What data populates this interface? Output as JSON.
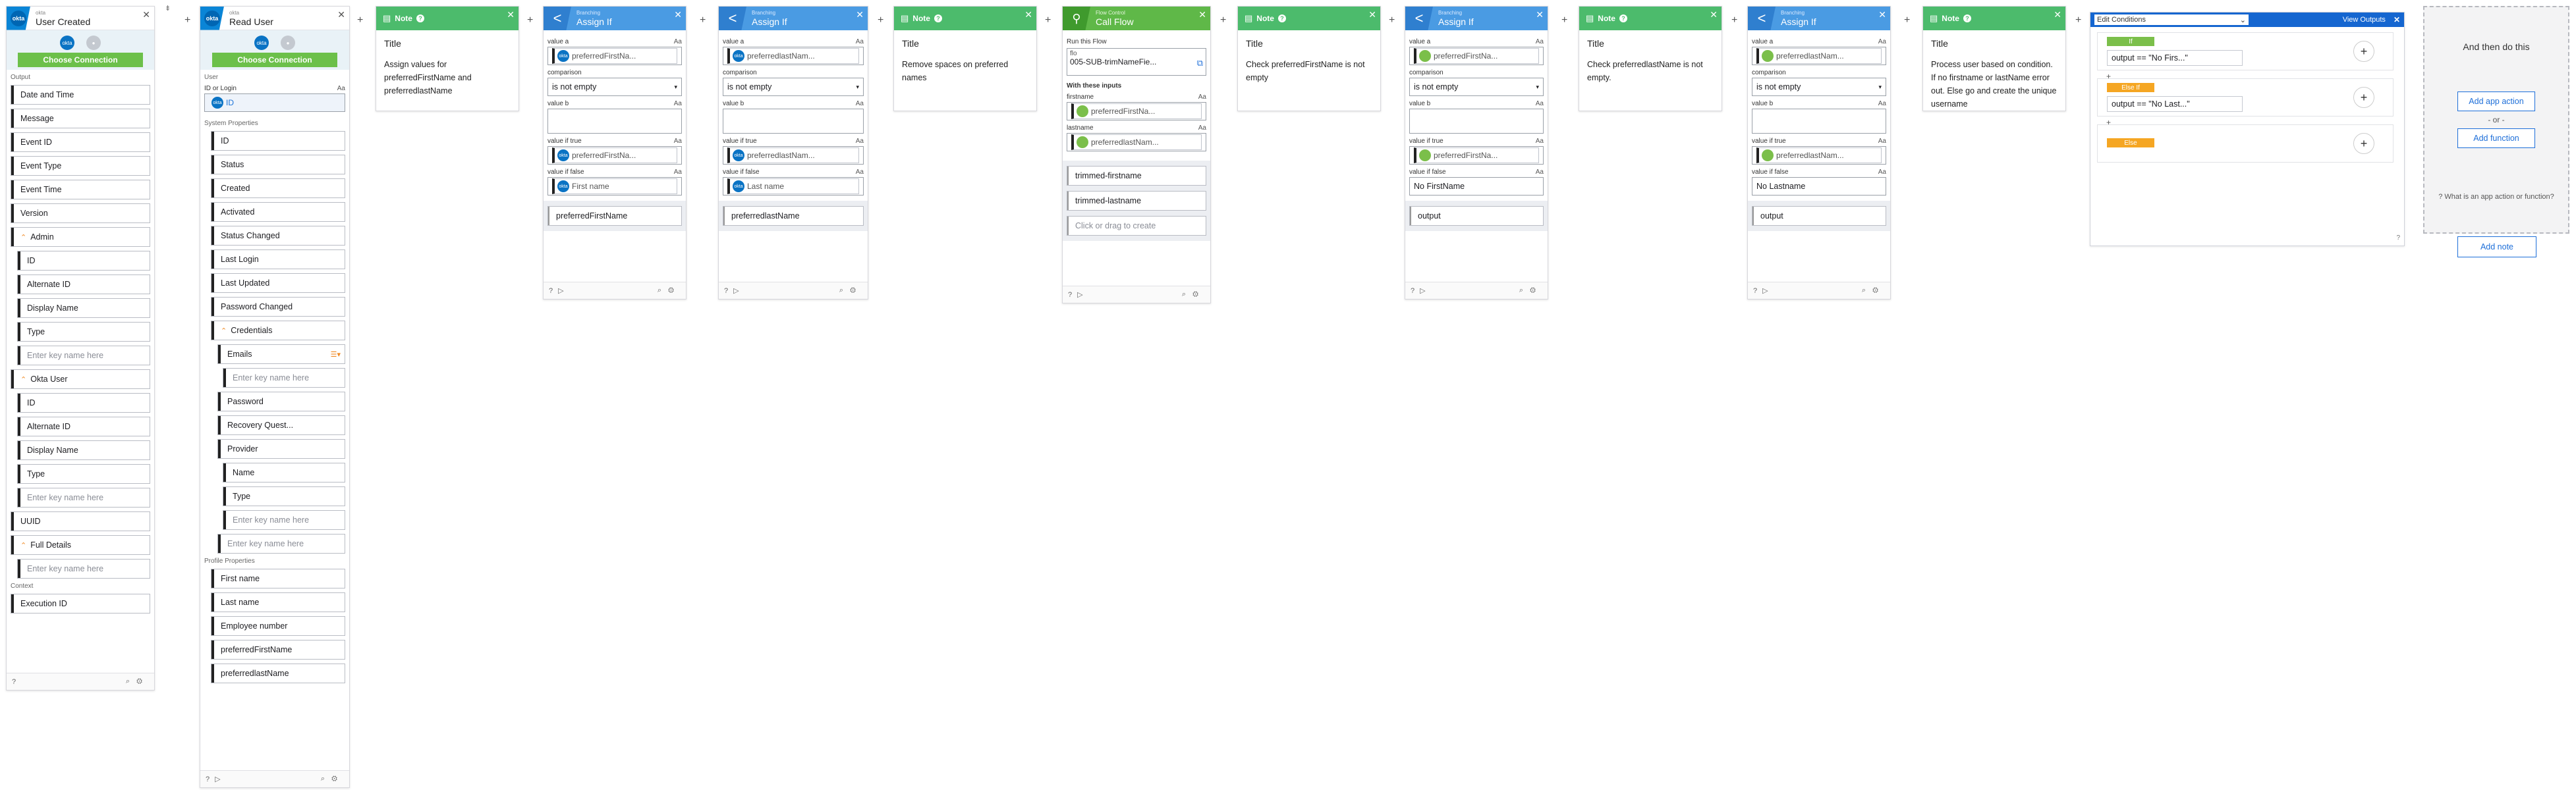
{
  "trigger": {
    "app": "okta",
    "title": "User Created",
    "logo_text": "okta",
    "connection_button": "Choose Connection",
    "output_label": "Output",
    "fields": [
      "Date and Time",
      "Message",
      "Event ID",
      "Event Type",
      "Event Time",
      "Version"
    ],
    "admin_label": "Admin",
    "admin_fields": [
      "ID",
      "Alternate ID",
      "Display Name",
      "Type"
    ],
    "placeholder": "Enter key name here",
    "okta_user_label": "Okta User",
    "okta_user_fields": [
      "ID",
      "Alternate ID",
      "Display Name",
      "Type"
    ],
    "uuid": "UUID",
    "full_details": "Full Details",
    "context_label": "Context",
    "execution_id": "Execution ID"
  },
  "read_user": {
    "app": "okta",
    "title": "Read User",
    "connection_button": "Choose Connection",
    "user_label": "User",
    "id_label": "ID or Login",
    "id_value": "ID",
    "sys_props_label": "System Properties",
    "sys_fields": [
      "ID",
      "Status",
      "Created",
      "Activated",
      "Status Changed",
      "Last Login",
      "Last Updated",
      "Password Changed"
    ],
    "credentials": "Credentials",
    "emails": "Emails",
    "placeholder": "Enter key name here",
    "cred_fields": [
      "Password",
      "Recovery Quest...",
      "Provider"
    ],
    "provider_fields": [
      "Name",
      "Type"
    ],
    "profile_label": "Profile Properties",
    "profile_fields": [
      "First name",
      "Last name",
      "Employee number",
      "preferredFirstName",
      "preferredlastName"
    ]
  },
  "note1": {
    "header": "Note",
    "title": "Title",
    "text": "Assign values for preferredFirstName and preferredlastName"
  },
  "assign1": {
    "small": "Branching",
    "title": "Assign If",
    "value_a": "value a",
    "a_val": "preferredFirstNa...",
    "comparison": "comparison",
    "comp_val": "is not empty",
    "value_b": "value b",
    "if_true": "value if true",
    "true_val": "preferredFirstNa...",
    "if_false": "value if false",
    "false_val": "First name",
    "output": "preferredFirstName"
  },
  "assign2": {
    "small": "Branching",
    "title": "Assign If",
    "value_a": "value a",
    "a_val": "preferredlastNam...",
    "comparison": "comparison",
    "comp_val": "is not empty",
    "value_b": "value b",
    "if_true": "value if true",
    "true_val": "preferredlastNam...",
    "if_false": "value if false",
    "false_val": "Last name",
    "output": "preferredlastName"
  },
  "note2": {
    "header": "Note",
    "title": "Title",
    "text": "Remove spaces on preferred names"
  },
  "callflow": {
    "small": "Flow Control",
    "title": "Call Flow",
    "run_label": "Run this Flow",
    "flow_label": "flo",
    "flow_value": "005-SUB-trimNameFie...",
    "inputs_label": "With these inputs",
    "firstname": "firstname",
    "first_val": "preferredFirstNa...",
    "lastname": "lastname",
    "last_val": "preferredlastNam...",
    "outputs": [
      "trimmed-firstname",
      "trimmed-lastname"
    ],
    "drag": "Click or drag to create"
  },
  "note3": {
    "header": "Note",
    "title": "Title",
    "text": "Check preferredFirstName is not empty"
  },
  "assign3": {
    "small": "Branching",
    "title": "Assign If",
    "value_a": "value a",
    "a_val": "preferredFirstNa...",
    "comparison": "comparison",
    "comp_val": "is not empty",
    "value_b": "value b",
    "if_true": "value if true",
    "true_val": "preferredFirstNa...",
    "if_false": "value if false",
    "false_val": "No FirstName",
    "output": "output"
  },
  "note4": {
    "header": "Note",
    "title": "Title",
    "text": "Check preferredlastName is not empty."
  },
  "assign4": {
    "small": "Branching",
    "title": "Assign If",
    "value_a": "value a",
    "a_val": "preferredlastNam...",
    "comparison": "comparison",
    "comp_val": "is not empty",
    "value_b": "value b",
    "if_true": "value if true",
    "true_val": "preferredlastNam...",
    "if_false": "value if false",
    "false_val": "No Lastname",
    "output": "output"
  },
  "note5": {
    "header": "Note",
    "title": "Title",
    "text": "Process user based on condition. If no firstname or lastName error out. Else go and create the unique username"
  },
  "conditions": {
    "select": "Edit Conditions",
    "view_outputs": "View Outputs",
    "if": "If",
    "if_val": "output == \"No Firs...\"",
    "elseif": "Else If",
    "elseif_val": "output == \"No Last...\"",
    "else": "Else",
    "if_color": "#7bbf4a",
    "elseif_color": "#f5a623",
    "else_color": "#f5a623"
  },
  "then": {
    "header": "And then do this",
    "app_action": "Add app action",
    "or": "- or -",
    "function": "Add function",
    "help": "What is an app action or function?",
    "add_note": "Add note"
  },
  "aa": "Aa"
}
